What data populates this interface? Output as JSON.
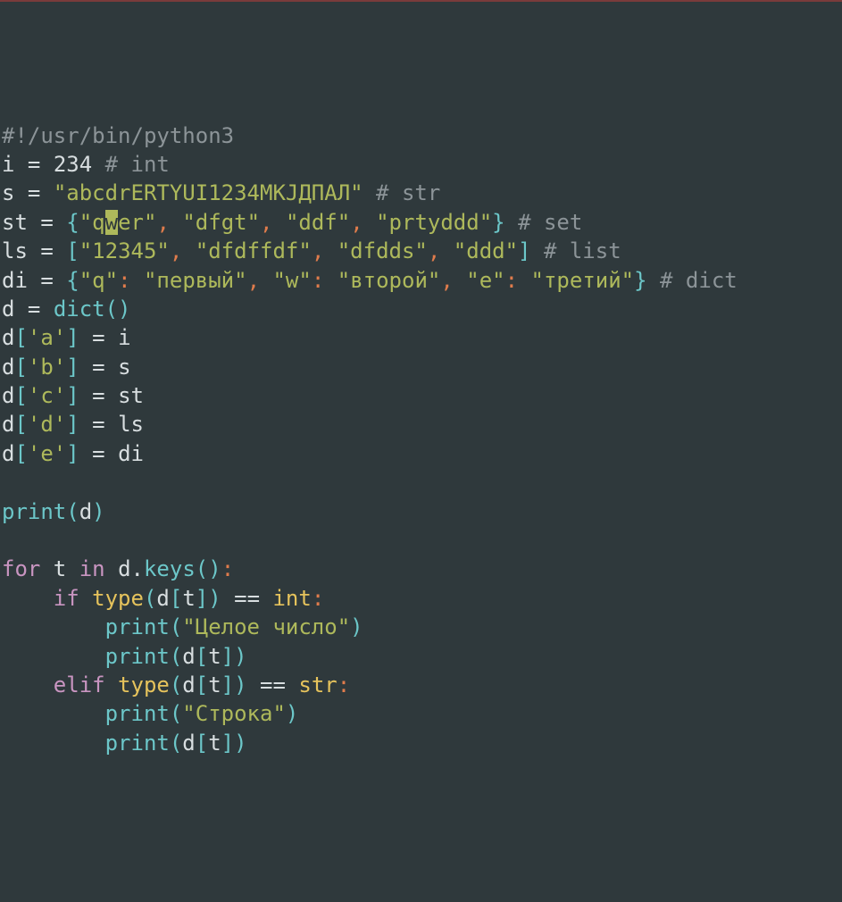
{
  "cursor": {
    "line": 3,
    "col": 11
  },
  "tokens": [
    [
      {
        "t": "#!/usr/bin/python3",
        "c": "c-comment"
      }
    ],
    [
      {
        "t": "i ",
        "c": "c-ident"
      },
      {
        "t": "=",
        "c": "c-op"
      },
      {
        "t": " ",
        "c": "c-ident"
      },
      {
        "t": "234",
        "c": "c-num"
      },
      {
        "t": " ",
        "c": "c-ident"
      },
      {
        "t": "# int",
        "c": "c-comment"
      }
    ],
    [
      {
        "t": "s ",
        "c": "c-ident"
      },
      {
        "t": "=",
        "c": "c-op"
      },
      {
        "t": " ",
        "c": "c-ident"
      },
      {
        "t": "\"abcdrERTYUI1234МКЈДПАЛ\"",
        "c": "c-str"
      },
      {
        "t": " ",
        "c": "c-ident"
      },
      {
        "t": "# str",
        "c": "c-comment"
      }
    ],
    [
      {
        "t": "st ",
        "c": "c-ident"
      },
      {
        "t": "=",
        "c": "c-op"
      },
      {
        "t": " ",
        "c": "c-ident"
      },
      {
        "t": "{",
        "c": "c-brace"
      },
      {
        "t": "\"q",
        "c": "c-str"
      },
      {
        "t": "w",
        "c": "cursor"
      },
      {
        "t": "er\"",
        "c": "c-str"
      },
      {
        "t": ",",
        "c": "c-punct"
      },
      {
        "t": " ",
        "c": "c-ident"
      },
      {
        "t": "\"dfgt\"",
        "c": "c-str"
      },
      {
        "t": ",",
        "c": "c-punct"
      },
      {
        "t": " ",
        "c": "c-ident"
      },
      {
        "t": "\"ddf\"",
        "c": "c-str"
      },
      {
        "t": ",",
        "c": "c-punct"
      },
      {
        "t": " ",
        "c": "c-ident"
      },
      {
        "t": "\"prtyddd\"",
        "c": "c-str"
      },
      {
        "t": "}",
        "c": "c-brace"
      },
      {
        "t": " ",
        "c": "c-ident"
      },
      {
        "t": "# set",
        "c": "c-comment"
      }
    ],
    [
      {
        "t": "ls ",
        "c": "c-ident"
      },
      {
        "t": "=",
        "c": "c-op"
      },
      {
        "t": " ",
        "c": "c-ident"
      },
      {
        "t": "[",
        "c": "c-brace"
      },
      {
        "t": "\"12345\"",
        "c": "c-str"
      },
      {
        "t": ",",
        "c": "c-punct"
      },
      {
        "t": " ",
        "c": "c-ident"
      },
      {
        "t": "\"dfdffdf\"",
        "c": "c-str"
      },
      {
        "t": ",",
        "c": "c-punct"
      },
      {
        "t": " ",
        "c": "c-ident"
      },
      {
        "t": "\"dfdds\"",
        "c": "c-str"
      },
      {
        "t": ",",
        "c": "c-punct"
      },
      {
        "t": " ",
        "c": "c-ident"
      },
      {
        "t": "\"ddd\"",
        "c": "c-str"
      },
      {
        "t": "]",
        "c": "c-brace"
      },
      {
        "t": " ",
        "c": "c-ident"
      },
      {
        "t": "# list",
        "c": "c-comment"
      }
    ],
    [
      {
        "t": "di ",
        "c": "c-ident"
      },
      {
        "t": "=",
        "c": "c-op"
      },
      {
        "t": " ",
        "c": "c-ident"
      },
      {
        "t": "{",
        "c": "c-brace"
      },
      {
        "t": "\"q\"",
        "c": "c-str"
      },
      {
        "t": ":",
        "c": "c-punct"
      },
      {
        "t": " ",
        "c": "c-ident"
      },
      {
        "t": "\"первый\"",
        "c": "c-str"
      },
      {
        "t": ",",
        "c": "c-punct"
      },
      {
        "t": " ",
        "c": "c-ident"
      },
      {
        "t": "\"w\"",
        "c": "c-str"
      },
      {
        "t": ":",
        "c": "c-punct"
      },
      {
        "t": " ",
        "c": "c-ident"
      },
      {
        "t": "\"второй\"",
        "c": "c-str"
      },
      {
        "t": ",",
        "c": "c-punct"
      },
      {
        "t": " ",
        "c": "c-ident"
      },
      {
        "t": "\"e\"",
        "c": "c-str"
      },
      {
        "t": ":",
        "c": "c-punct"
      },
      {
        "t": " ",
        "c": "c-ident"
      },
      {
        "t": "\"третий\"",
        "c": "c-str"
      },
      {
        "t": "}",
        "c": "c-brace"
      },
      {
        "t": " ",
        "c": "c-ident"
      },
      {
        "t": "# dict",
        "c": "c-comment"
      }
    ],
    [
      {
        "t": "d ",
        "c": "c-ident"
      },
      {
        "t": "=",
        "c": "c-op"
      },
      {
        "t": " ",
        "c": "c-ident"
      },
      {
        "t": "dict",
        "c": "c-func"
      },
      {
        "t": "()",
        "c": "c-brace"
      }
    ],
    [
      {
        "t": "d",
        "c": "c-ident"
      },
      {
        "t": "[",
        "c": "c-brace"
      },
      {
        "t": "'a'",
        "c": "c-str"
      },
      {
        "t": "]",
        "c": "c-brace"
      },
      {
        "t": " ",
        "c": "c-ident"
      },
      {
        "t": "=",
        "c": "c-op"
      },
      {
        "t": " i",
        "c": "c-ident"
      }
    ],
    [
      {
        "t": "d",
        "c": "c-ident"
      },
      {
        "t": "[",
        "c": "c-brace"
      },
      {
        "t": "'b'",
        "c": "c-str"
      },
      {
        "t": "]",
        "c": "c-brace"
      },
      {
        "t": " ",
        "c": "c-ident"
      },
      {
        "t": "=",
        "c": "c-op"
      },
      {
        "t": " s",
        "c": "c-ident"
      }
    ],
    [
      {
        "t": "d",
        "c": "c-ident"
      },
      {
        "t": "[",
        "c": "c-brace"
      },
      {
        "t": "'c'",
        "c": "c-str"
      },
      {
        "t": "]",
        "c": "c-brace"
      },
      {
        "t": " ",
        "c": "c-ident"
      },
      {
        "t": "=",
        "c": "c-op"
      },
      {
        "t": " st",
        "c": "c-ident"
      }
    ],
    [
      {
        "t": "d",
        "c": "c-ident"
      },
      {
        "t": "[",
        "c": "c-brace"
      },
      {
        "t": "'d'",
        "c": "c-str"
      },
      {
        "t": "]",
        "c": "c-brace"
      },
      {
        "t": " ",
        "c": "c-ident"
      },
      {
        "t": "=",
        "c": "c-op"
      },
      {
        "t": " ls",
        "c": "c-ident"
      }
    ],
    [
      {
        "t": "d",
        "c": "c-ident"
      },
      {
        "t": "[",
        "c": "c-brace"
      },
      {
        "t": "'e'",
        "c": "c-str"
      },
      {
        "t": "]",
        "c": "c-brace"
      },
      {
        "t": " ",
        "c": "c-ident"
      },
      {
        "t": "=",
        "c": "c-op"
      },
      {
        "t": " di",
        "c": "c-ident"
      }
    ],
    [
      {
        "t": "",
        "c": "c-ident"
      }
    ],
    [
      {
        "t": "print",
        "c": "c-func"
      },
      {
        "t": "(",
        "c": "c-brace"
      },
      {
        "t": "d",
        "c": "c-ident"
      },
      {
        "t": ")",
        "c": "c-brace"
      }
    ],
    [
      {
        "t": "",
        "c": "c-ident"
      }
    ],
    [
      {
        "t": "for",
        "c": "c-kw"
      },
      {
        "t": " t ",
        "c": "c-ident"
      },
      {
        "t": "in",
        "c": "c-kw"
      },
      {
        "t": " d.",
        "c": "c-ident"
      },
      {
        "t": "keys",
        "c": "c-func"
      },
      {
        "t": "()",
        "c": "c-brace"
      },
      {
        "t": ":",
        "c": "c-punct"
      }
    ],
    [
      {
        "t": "    ",
        "c": "c-ident"
      },
      {
        "t": "if",
        "c": "c-kw"
      },
      {
        "t": " ",
        "c": "c-ident"
      },
      {
        "t": "type",
        "c": "c-builtin"
      },
      {
        "t": "(",
        "c": "c-brace"
      },
      {
        "t": "d",
        "c": "c-ident"
      },
      {
        "t": "[",
        "c": "c-brace"
      },
      {
        "t": "t",
        "c": "c-ident"
      },
      {
        "t": "])",
        "c": "c-brace"
      },
      {
        "t": " ",
        "c": "c-ident"
      },
      {
        "t": "==",
        "c": "c-op"
      },
      {
        "t": " ",
        "c": "c-ident"
      },
      {
        "t": "int",
        "c": "c-builtin"
      },
      {
        "t": ":",
        "c": "c-punct"
      }
    ],
    [
      {
        "t": "        ",
        "c": "c-ident"
      },
      {
        "t": "print",
        "c": "c-func"
      },
      {
        "t": "(",
        "c": "c-brace"
      },
      {
        "t": "\"Целое число\"",
        "c": "c-str"
      },
      {
        "t": ")",
        "c": "c-brace"
      }
    ],
    [
      {
        "t": "        ",
        "c": "c-ident"
      },
      {
        "t": "print",
        "c": "c-func"
      },
      {
        "t": "(",
        "c": "c-brace"
      },
      {
        "t": "d",
        "c": "c-ident"
      },
      {
        "t": "[",
        "c": "c-brace"
      },
      {
        "t": "t",
        "c": "c-ident"
      },
      {
        "t": "])",
        "c": "c-brace"
      }
    ],
    [
      {
        "t": "    ",
        "c": "c-ident"
      },
      {
        "t": "elif",
        "c": "c-kw"
      },
      {
        "t": " ",
        "c": "c-ident"
      },
      {
        "t": "type",
        "c": "c-builtin"
      },
      {
        "t": "(",
        "c": "c-brace"
      },
      {
        "t": "d",
        "c": "c-ident"
      },
      {
        "t": "[",
        "c": "c-brace"
      },
      {
        "t": "t",
        "c": "c-ident"
      },
      {
        "t": "])",
        "c": "c-brace"
      },
      {
        "t": " ",
        "c": "c-ident"
      },
      {
        "t": "==",
        "c": "c-op"
      },
      {
        "t": " ",
        "c": "c-ident"
      },
      {
        "t": "str",
        "c": "c-builtin"
      },
      {
        "t": ":",
        "c": "c-punct"
      }
    ],
    [
      {
        "t": "        ",
        "c": "c-ident"
      },
      {
        "t": "print",
        "c": "c-func"
      },
      {
        "t": "(",
        "c": "c-brace"
      },
      {
        "t": "\"Строка\"",
        "c": "c-str"
      },
      {
        "t": ")",
        "c": "c-brace"
      }
    ],
    [
      {
        "t": "        ",
        "c": "c-ident"
      },
      {
        "t": "print",
        "c": "c-func"
      },
      {
        "t": "(",
        "c": "c-brace"
      },
      {
        "t": "d",
        "c": "c-ident"
      },
      {
        "t": "[",
        "c": "c-brace"
      },
      {
        "t": "t",
        "c": "c-ident"
      },
      {
        "t": "])",
        "c": "c-brace"
      }
    ]
  ]
}
